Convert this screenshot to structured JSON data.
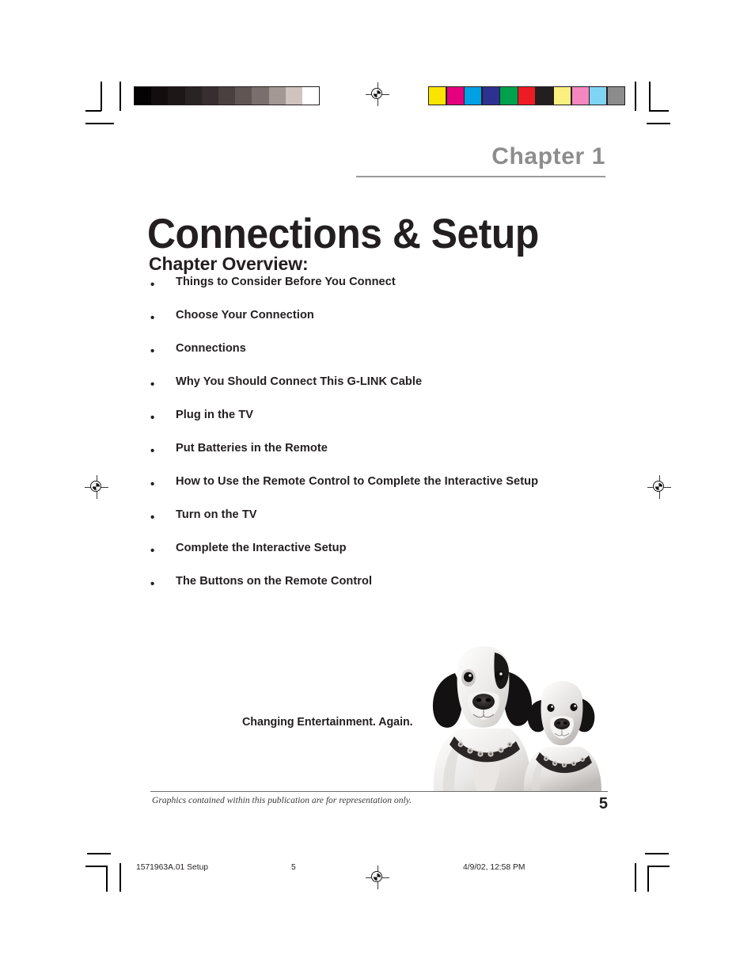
{
  "document": {
    "chapter_label": "Chapter 1",
    "chapter_title": "Connections & Setup",
    "overview_heading": "Chapter Overview:",
    "overview_items": [
      "Things to Consider Before You Connect",
      "Choose Your Connection",
      "Connections",
      "Why You Should Connect This G-LINK Cable",
      "Plug in the TV",
      "Put Batteries in the Remote",
      "How to Use the Remote Control to Complete the Interactive Setup",
      "Turn on the TV",
      "Complete the Interactive Setup",
      "The Buttons on the Remote Control"
    ],
    "bullet_glyph": "•",
    "tagline": "Changing Entertainment. Again.",
    "footnote": "Graphics contained within this publication are for representation only.",
    "page_number": "5"
  },
  "print_footer": {
    "job": "1571963A.01 Setup",
    "page": "5",
    "timestamp": "4/9/02, 12:58 PM"
  },
  "calibration": {
    "grayscale_swatches": [
      "#050203",
      "#120d0e",
      "#1d1718",
      "#2a2324",
      "#372f2f",
      "#4a4040",
      "#5f5554",
      "#7a6f6c",
      "#a39894",
      "#cfc4c0",
      "#ffffff"
    ],
    "color_swatches": [
      "#fbe500",
      "#e5007e",
      "#00a0e4",
      "#2e3192",
      "#00a14b",
      "#ed1c24",
      "#231f20",
      "#fbf07f",
      "#f487bf",
      "#7fd4f4",
      "#8c8c8c"
    ]
  },
  "colors": {
    "chapter_label_gray": "#8d8d8d",
    "ink_black": "#231f20",
    "rule_gray": "#9a9a9a"
  },
  "marks": {
    "registration_left": "registration-target",
    "registration_right": "registration-target",
    "registration_top": "registration-target",
    "registration_bottom": "registration-target"
  },
  "photo": {
    "caption": "two dogs with studded collars"
  }
}
